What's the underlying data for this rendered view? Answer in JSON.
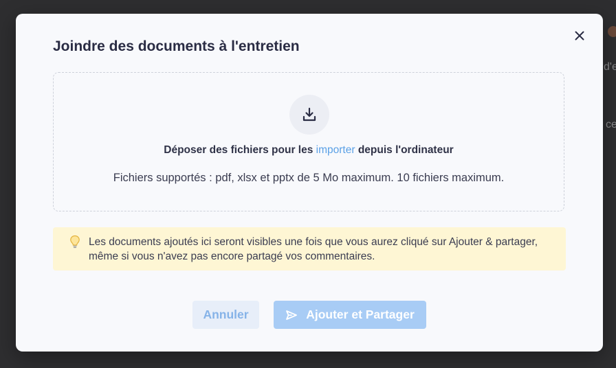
{
  "background": {
    "fragments": [
      "d'e",
      "ce"
    ]
  },
  "modal": {
    "title": "Joindre des documents à l'entretien",
    "close_icon": "close-icon"
  },
  "dropzone": {
    "icon": "download-icon",
    "text_before": "Déposer des fichiers pour les ",
    "link_text": "importer",
    "text_after": " depuis l'ordinateur",
    "supported": "Fichiers supportés : pdf, xlsx et pptx de 5 Mo maximum. 10 fichiers maximum."
  },
  "info": {
    "icon": "lightbulb-icon",
    "text": "Les documents ajoutés ici seront visibles une fois que vous aurez cliqué sur Ajouter & partager, même si vous n'avez pas encore partagé vos commentaires."
  },
  "actions": {
    "cancel_label": "Annuler",
    "submit_label": "Ajouter et Partager",
    "submit_icon": "send-icon"
  },
  "colors": {
    "accent": "#5aa0e6",
    "submit_bg": "#a8ccf5",
    "info_bg": "#fef6d4",
    "title": "#2a2c44"
  }
}
